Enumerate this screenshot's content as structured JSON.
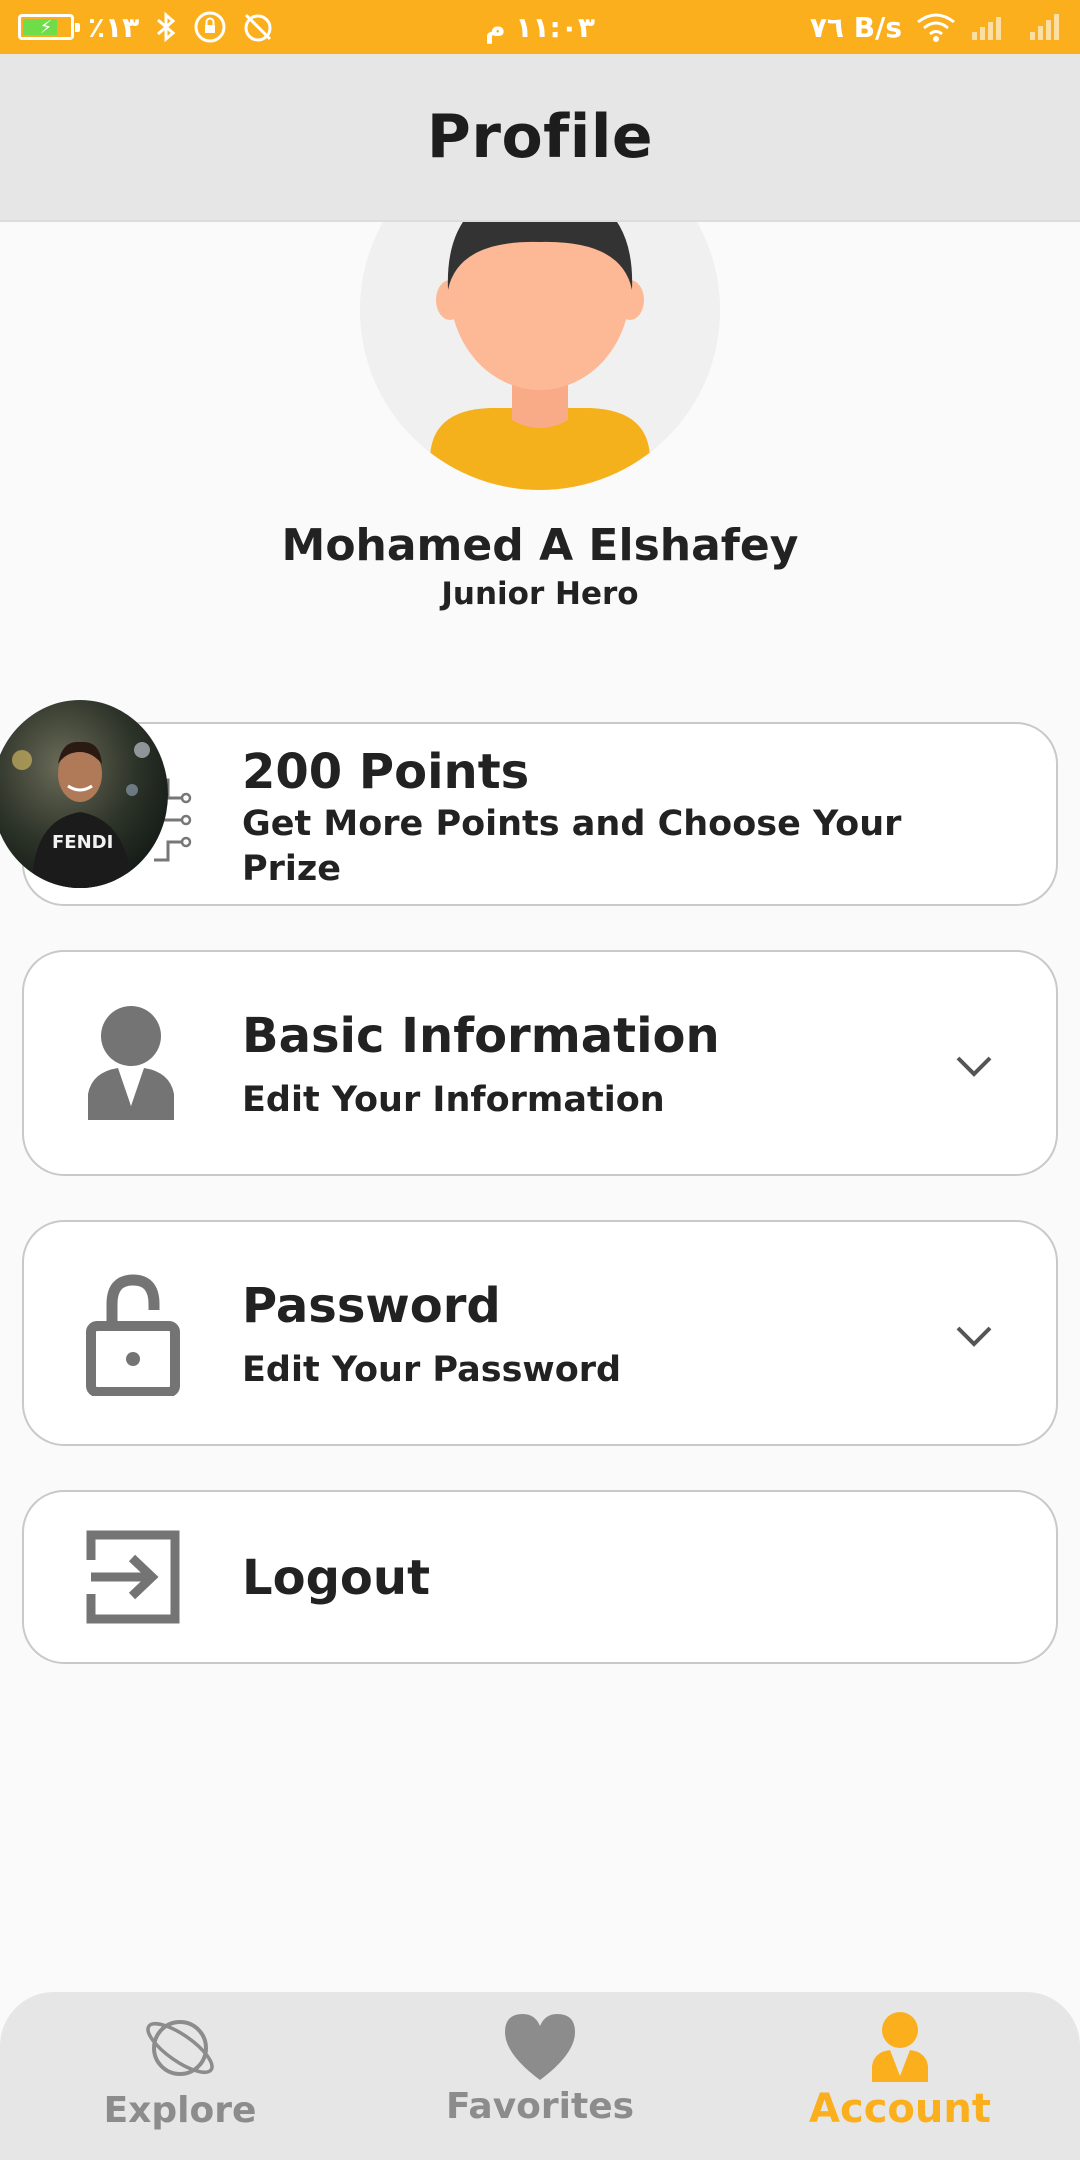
{
  "status_bar": {
    "battery": "⚡",
    "battery_pct": "٪١٣",
    "time": "١١:٠٣ م",
    "net_speed": "٧٦ B/s"
  },
  "header": {
    "title": "Profile"
  },
  "profile": {
    "name": "Mohamed A Elshafey",
    "level": "Junior Hero"
  },
  "points": {
    "title": "200 Points",
    "subtitle": "Get More Points and Choose Your Prize"
  },
  "menu": {
    "basic_info": {
      "title": "Basic Information",
      "subtitle": "Edit Your Information"
    },
    "password": {
      "title": "Password",
      "subtitle": "Edit Your Password"
    },
    "logout": {
      "title": "Logout"
    }
  },
  "bottom_nav": {
    "items": [
      {
        "label": "Explore",
        "icon": "planet-icon"
      },
      {
        "label": "Favorites",
        "icon": "heart-icon"
      },
      {
        "label": "Account",
        "icon": "person-icon"
      }
    ],
    "active": "Account"
  },
  "colors": {
    "accent": "#fbaf1d",
    "header_bg": "#e6e6e6",
    "icon_gray": "#747474"
  }
}
